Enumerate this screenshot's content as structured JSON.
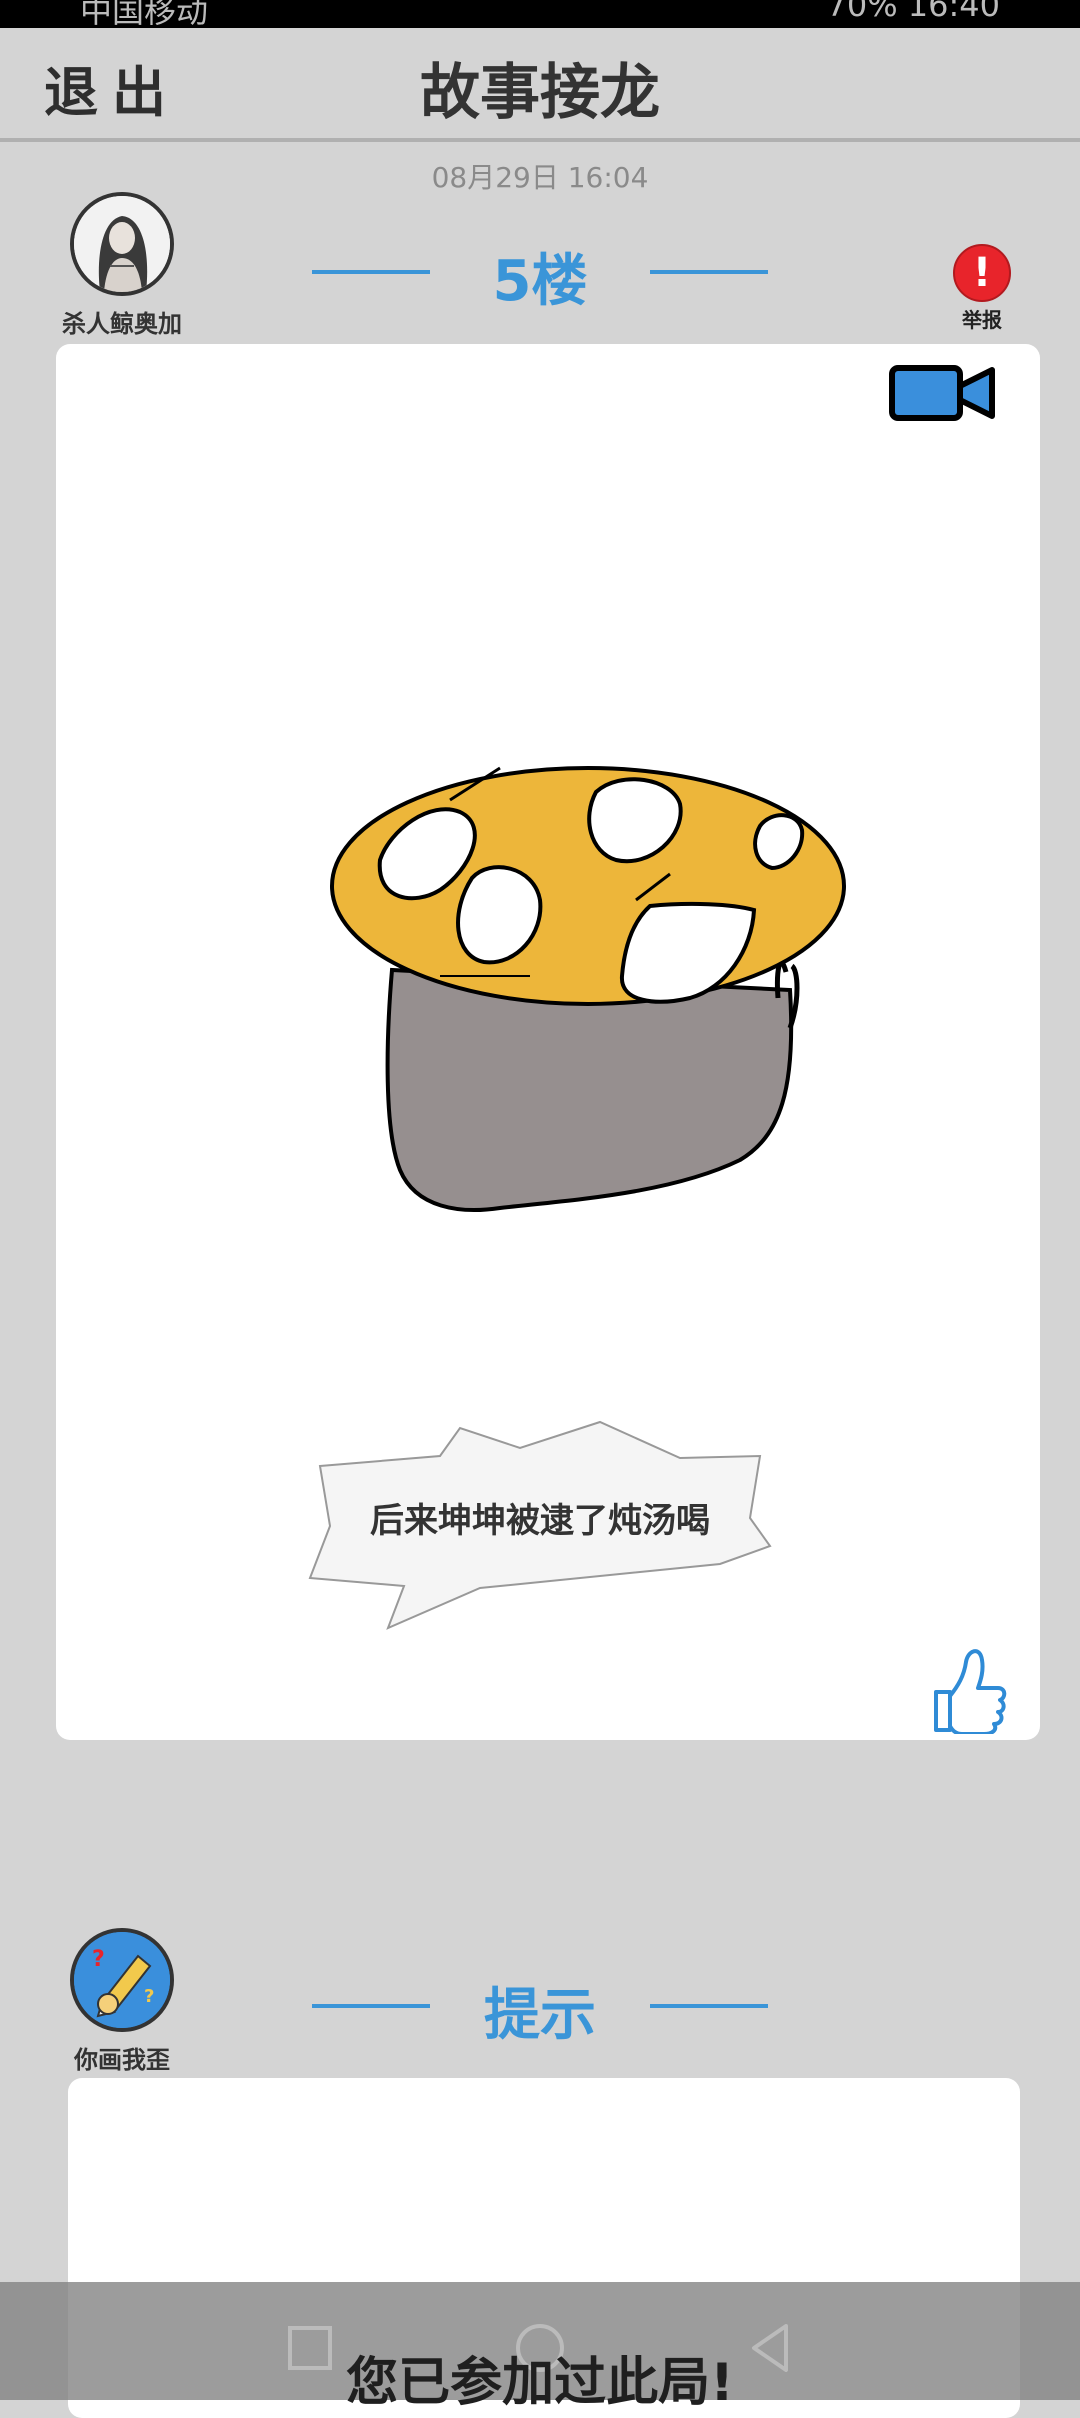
{
  "status_bar": {
    "carrier": "中国移动",
    "battery": "70%",
    "time": "16:40"
  },
  "header": {
    "exit_label": "退出",
    "title": "故事接龙"
  },
  "post": {
    "time": "08月29日  16:04",
    "author": "杀人鲸奥加",
    "floor": "5楼",
    "report_label": "举报",
    "caption": "后来坤坤被逮了炖汤喝"
  },
  "hint": {
    "author": "你画我歪",
    "title": "提示",
    "joined_message": "您已参加过此局!"
  },
  "colors": {
    "accent": "#3a95d8",
    "report": "#e8242b",
    "pot_top": "#edb63a",
    "pot_body": "#968f8f"
  },
  "icons": [
    "video-camera-icon",
    "report-icon",
    "thumbs-up-icon",
    "nav-recent-icon",
    "nav-home-icon",
    "nav-back-icon"
  ]
}
